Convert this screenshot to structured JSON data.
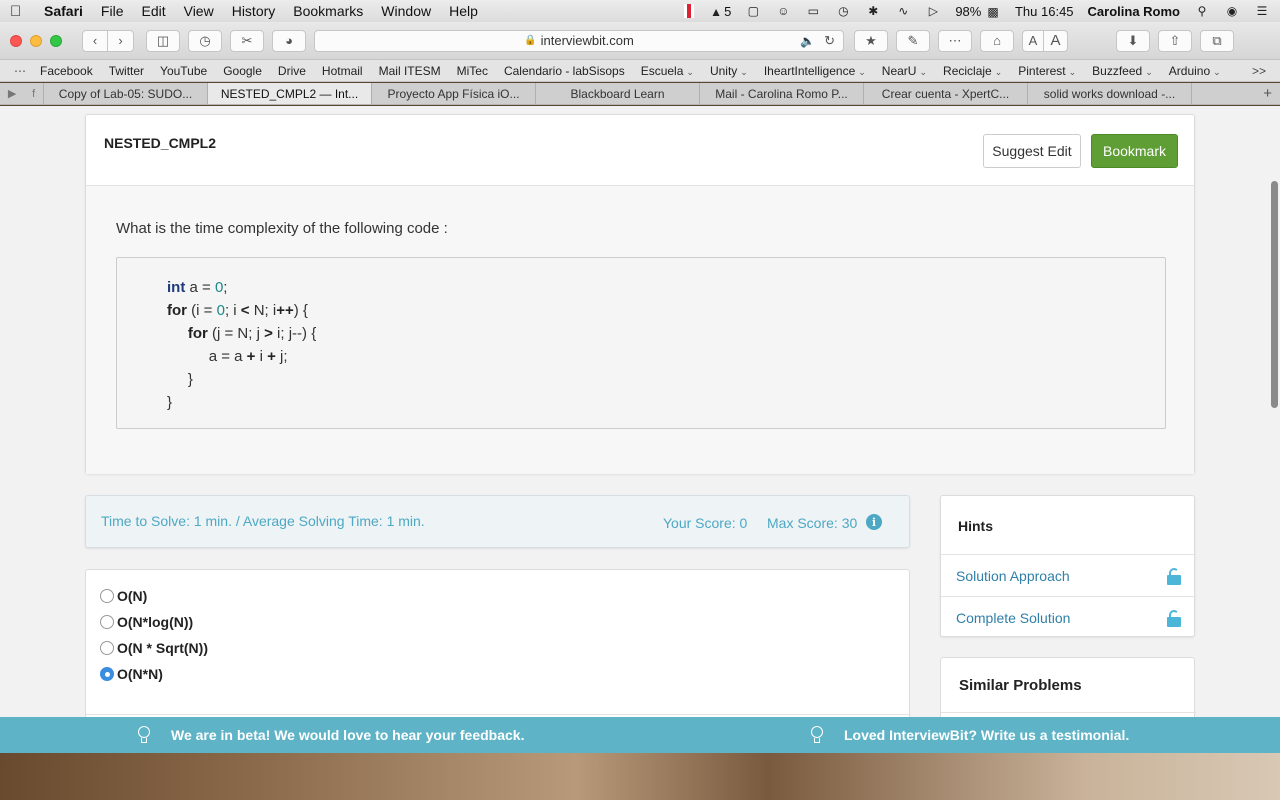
{
  "menubar": {
    "app": "Safari",
    "items": [
      "File",
      "Edit",
      "View",
      "History",
      "Bookmarks",
      "Window",
      "Help"
    ],
    "badge_count": "5",
    "battery": "98%",
    "clock": "Thu 16:45",
    "user": "Carolina Romo"
  },
  "toolbar": {
    "url": "interviewbit.com",
    "text_small": "A",
    "text_large": "A"
  },
  "bookmarks": {
    "items": [
      "Facebook",
      "Twitter",
      "YouTube",
      "Google",
      "Drive",
      "Hotmail",
      "Mail ITESM",
      "MiTec",
      "Calendario - labSisops",
      "Escuela",
      "Unity",
      "IheartIntelligence",
      "NearU",
      "Reciclaje",
      "Pinterest",
      "Buzzfeed",
      "Arduino"
    ],
    "folders": [
      "Escuela",
      "Unity",
      "IheartIntelligence",
      "NearU",
      "Reciclaje",
      "Pinterest",
      "Buzzfeed",
      "Arduino"
    ],
    "more": ">>"
  },
  "tabs": [
    {
      "label": "Copy of Lab-05: SUDO...",
      "active": false
    },
    {
      "label": "NESTED_CMPL2 — Int...",
      "active": true
    },
    {
      "label": "Proyecto App Física iO...",
      "active": false
    },
    {
      "label": "Blackboard Learn",
      "active": false
    },
    {
      "label": "Mail - Carolina Romo P...",
      "active": false
    },
    {
      "label": "Crear cuenta - XpertC...",
      "active": false
    },
    {
      "label": "solid works download -...",
      "active": false
    }
  ],
  "problem": {
    "title": "NESTED_CMPL2",
    "suggest_label": "Suggest Edit",
    "bookmark_label": "Bookmark",
    "question": "What is the time complexity of the following code :",
    "code": {
      "l1_type": "int",
      "l1_rest": " a = ",
      "l1_num": "0",
      "l1_end": ";",
      "l2_kw": "for",
      "l2_a": " (i = ",
      "l2_num": "0",
      "l2_b": "; i ",
      "l2_op": "<",
      "l2_c": " N; i",
      "l2_inc": "++",
      "l2_d": ") {",
      "l3_indent": "     ",
      "l3_kw": "for",
      "l3_a": " (j = N; j ",
      "l3_op": ">",
      "l3_b": " i; j--) {",
      "l4_indent": "          ",
      "l4_a": "a = a ",
      "l4_p1": "+",
      "l4_b": " i ",
      "l4_p2": "+",
      "l4_c": " j;",
      "l5": "     }",
      "l6": "}"
    }
  },
  "stats": {
    "time": "Time to Solve: 1 min. / Average Solving Time: 1 min.",
    "score": "Your Score: 0",
    "max": "Max Score: 30",
    "info": "i"
  },
  "options": [
    {
      "label": "O(N)",
      "checked": false
    },
    {
      "label": "O(N*log(N))",
      "checked": false
    },
    {
      "label": "O(N * Sqrt(N))",
      "checked": false
    },
    {
      "label": "O(N*N)",
      "checked": true
    }
  ],
  "hints": {
    "title": "Hints",
    "items": [
      "Solution Approach",
      "Complete Solution"
    ]
  },
  "similar": {
    "title": "Similar Problems"
  },
  "feedback": {
    "left": "We are in beta! We would love to hear your feedback.",
    "right": "Loved InterviewBit? Write us a testimonial."
  },
  "colors": {
    "bookmark_green": "#5e9e35",
    "accent_teal": "#4da8c4",
    "feedback_bar": "#5eb3c6",
    "radio_selected": "#3b8de0"
  }
}
